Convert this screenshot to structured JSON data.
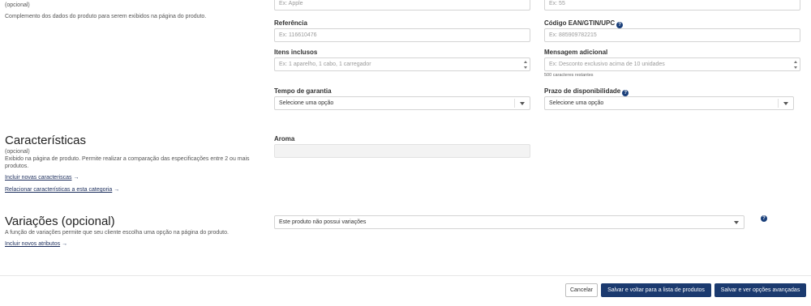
{
  "basic_info": {
    "optional_label": "(opcional)",
    "description": "Complemento dos dados do produto para serem exibidos na página do produto."
  },
  "fields": {
    "brand_placeholder": "Ex: Apple",
    "model_placeholder": "Ex: 55",
    "reference_label": "Referência",
    "reference_placeholder": "Ex: 116610476",
    "ean_label": "Código EAN/GTIN/UPC",
    "ean_placeholder": "Ex: 885909782215",
    "included_items_label": "Itens inclusos",
    "included_items_placeholder": "Ex: 1 aparelho, 1 cabo, 1 carregador",
    "additional_message_label": "Mensagem adicional",
    "additional_message_placeholder": "Ex: Desconto exclusivo acima de 10 unidades",
    "chars_remaining": "500 caracteres restantes",
    "warranty_label": "Tempo de garantia",
    "warranty_value": "Selecione uma opção",
    "availability_label": "Prazo de disponibilidade",
    "availability_value": "Selecione uma opção"
  },
  "characteristics": {
    "title": "Características",
    "optional_label": "(opcional)",
    "description": "Exibido na página de produto. Permite realizar a comparação das especificações entre 2 ou mais produtos.",
    "include_link": "Incluir novas caracteriscas",
    "relate_link": "Relacionar características a esta categoria",
    "aroma_label": "Aroma",
    "aroma_value": ""
  },
  "variations": {
    "title": "Variações (opcional)",
    "description": "A função de variações permite que seu cliente escolha uma opção na página do produto.",
    "include_link": "Incluir novos atributos",
    "select_value": "Este produto não possui variações"
  },
  "footer": {
    "cancel": "Cancelar",
    "save_back": "Salvar e voltar para a lista de produtos",
    "save_advanced": "Salvar e ver opções avançadas"
  },
  "colors": {
    "primary": "#1b3a6f",
    "help_icon": "#1a3f7a",
    "link": "#1a2c5b"
  }
}
